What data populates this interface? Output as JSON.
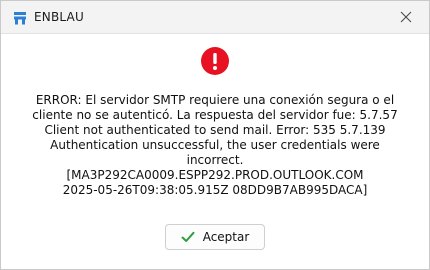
{
  "window": {
    "title": "ENBLAU",
    "app_icon": "enblau-app-icon",
    "close_icon": "close-icon"
  },
  "dialog": {
    "icon": "error-icon",
    "message_lines": [
      "ERROR: El servidor SMTP requiere una conexión segura o el",
      "cliente no se autenticó. La respuesta del servidor fue: 5.7.57",
      "Client not authenticated to send mail. Error: 535 5.7.139",
      "Authentication unsuccessful, the user credentials were",
      "incorrect.",
      "[MA3P292CA0009.ESPP292.PROD.OUTLOOK.COM",
      "2025-05-26T09:38:05.915Z 08DD9B7AB995DACA]"
    ]
  },
  "buttons": {
    "accept_label": "Aceptar",
    "accept_icon": "check-icon"
  },
  "colors": {
    "error_red": "#e81123",
    "check_green": "#2e9e3e",
    "app_icon_blue": "#2d7fd3"
  }
}
